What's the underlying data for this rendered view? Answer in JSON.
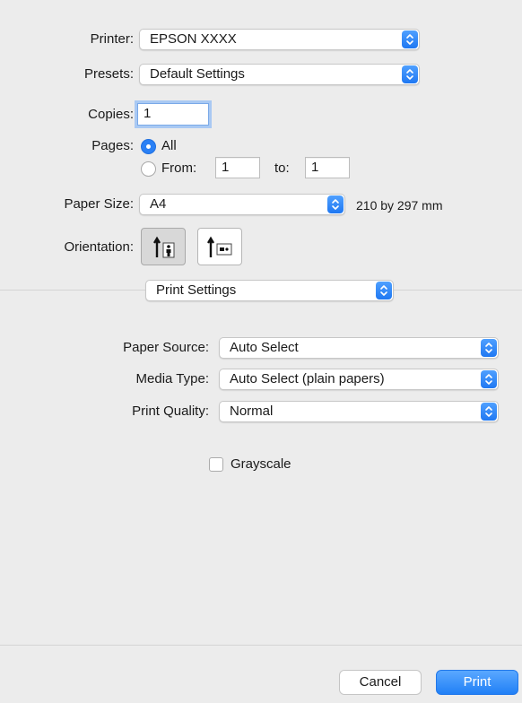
{
  "printer": {
    "label": "Printer:",
    "value": "EPSON XXXX"
  },
  "presets": {
    "label": "Presets:",
    "value": "Default Settings"
  },
  "copies": {
    "label": "Copies:",
    "value": "1"
  },
  "pages": {
    "label": "Pages:",
    "all_label": "All",
    "from_label": "From:",
    "from_value": "1",
    "to_label": "to:",
    "to_value": "1",
    "selected": "All"
  },
  "paper_size": {
    "label": "Paper Size:",
    "value": "A4",
    "dimensions": "210 by 297 mm"
  },
  "orientation": {
    "label": "Orientation:",
    "selected": "portrait"
  },
  "section_popup": {
    "value": "Print Settings"
  },
  "paper_source": {
    "label": "Paper Source:",
    "value": "Auto Select"
  },
  "media_type": {
    "label": "Media Type:",
    "value": "Auto Select (plain papers)"
  },
  "print_quality": {
    "label": "Print Quality:",
    "value": "Normal"
  },
  "grayscale": {
    "label": "Grayscale",
    "checked": false
  },
  "buttons": {
    "cancel": "Cancel",
    "print": "Print"
  },
  "colors": {
    "accent": "#2a80f5",
    "background": "#ececec"
  }
}
